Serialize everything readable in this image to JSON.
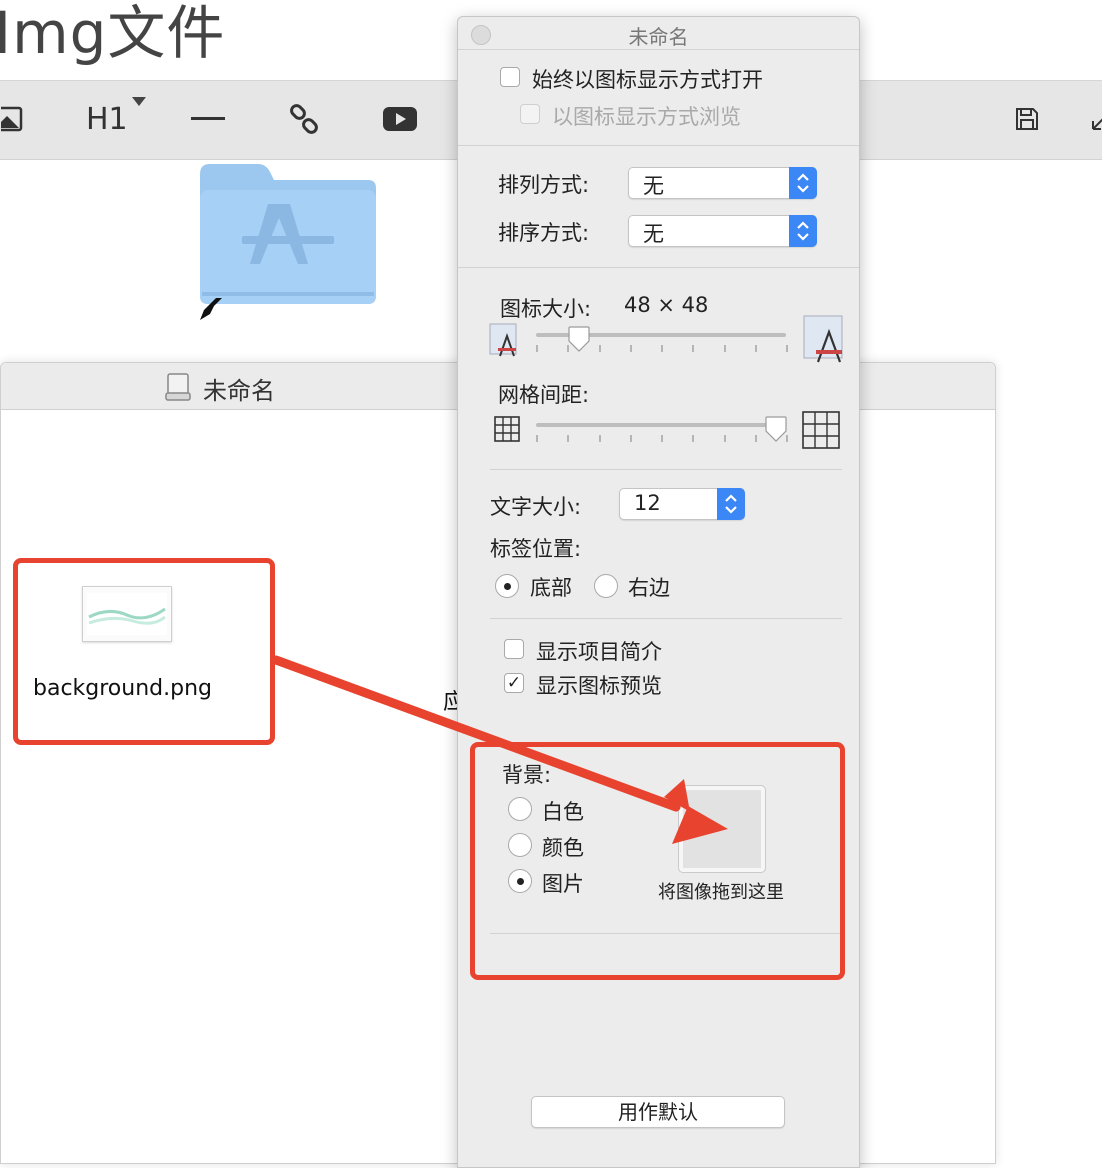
{
  "editor": {
    "doc_title": "Img文件",
    "toolbar": {
      "heading_label": "H1"
    }
  },
  "finder": {
    "title": "未命名",
    "file": {
      "name": "background.png"
    },
    "partial_text": "应"
  },
  "view_options": {
    "title": "未命名",
    "always_open_icon_view": {
      "label": "始终以图标显示方式打开",
      "checked": false
    },
    "browse_icon_view": {
      "label": "以图标显示方式浏览",
      "checked": false,
      "disabled": true
    },
    "arrange_by": {
      "label": "排列方式:",
      "value": "无"
    },
    "sort_by": {
      "label": "排序方式:",
      "value": "无"
    },
    "icon_size": {
      "label": "图标大小:",
      "value": "48 × 48",
      "slider_fraction": 0.17
    },
    "grid_spacing": {
      "label": "网格间距:",
      "slider_fraction": 0.96
    },
    "text_size": {
      "label": "文字大小:",
      "value": "12"
    },
    "label_position": {
      "label": "标签位置:",
      "options": [
        {
          "label": "底部",
          "selected": true
        },
        {
          "label": "右边",
          "selected": false
        }
      ]
    },
    "show_item_info": {
      "label": "显示项目简介",
      "checked": false
    },
    "show_icon_preview": {
      "label": "显示图标预览",
      "checked": true
    },
    "background": {
      "label": "背景:",
      "options": [
        {
          "label": "白色",
          "selected": false
        },
        {
          "label": "颜色",
          "selected": false
        },
        {
          "label": "图片",
          "selected": true
        }
      ],
      "drop_label": "将图像拖到这里"
    },
    "use_as_defaults": "用作默认"
  },
  "annotation": {
    "color": "#e8432f"
  },
  "accent_color": "#3b87f5"
}
